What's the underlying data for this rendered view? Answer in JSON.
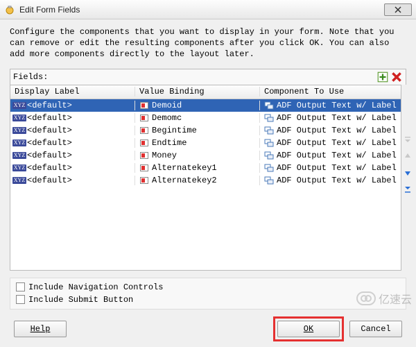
{
  "window": {
    "title": "Edit Form Fields"
  },
  "instruction": "Configure the components that you want to display in your form.  Note that you can remove or edit the resulting components after you click OK.  You can also add more components directly to the layout later.",
  "fields_label": "Fields:",
  "columns": {
    "display_label": "Display Label",
    "value_binding": "Value Binding",
    "component": "Component To Use"
  },
  "rows": [
    {
      "label": "<default>",
      "binding": "Demoid",
      "component": "ADF Output Text w/ Label",
      "selected": true
    },
    {
      "label": "<default>",
      "binding": "Demomc",
      "component": "ADF Output Text w/ Label",
      "selected": false
    },
    {
      "label": "<default>",
      "binding": "Begintime",
      "component": "ADF Output Text w/ Label",
      "selected": false
    },
    {
      "label": "<default>",
      "binding": "Endtime",
      "component": "ADF Output Text w/ Label",
      "selected": false
    },
    {
      "label": "<default>",
      "binding": "Money",
      "component": "ADF Output Text w/ Label",
      "selected": false
    },
    {
      "label": "<default>",
      "binding": "Alternatekey1",
      "component": "ADF Output Text w/ Label",
      "selected": false
    },
    {
      "label": "<default>",
      "binding": "Alternatekey2",
      "component": "ADF Output Text w/ Label",
      "selected": false
    }
  ],
  "checkboxes": {
    "include_nav": "Include Navigation Controls",
    "include_submit": "Include Submit Button"
  },
  "buttons": {
    "help": "Help",
    "ok": "OK",
    "cancel": "Cancel"
  },
  "watermark": "亿速云"
}
